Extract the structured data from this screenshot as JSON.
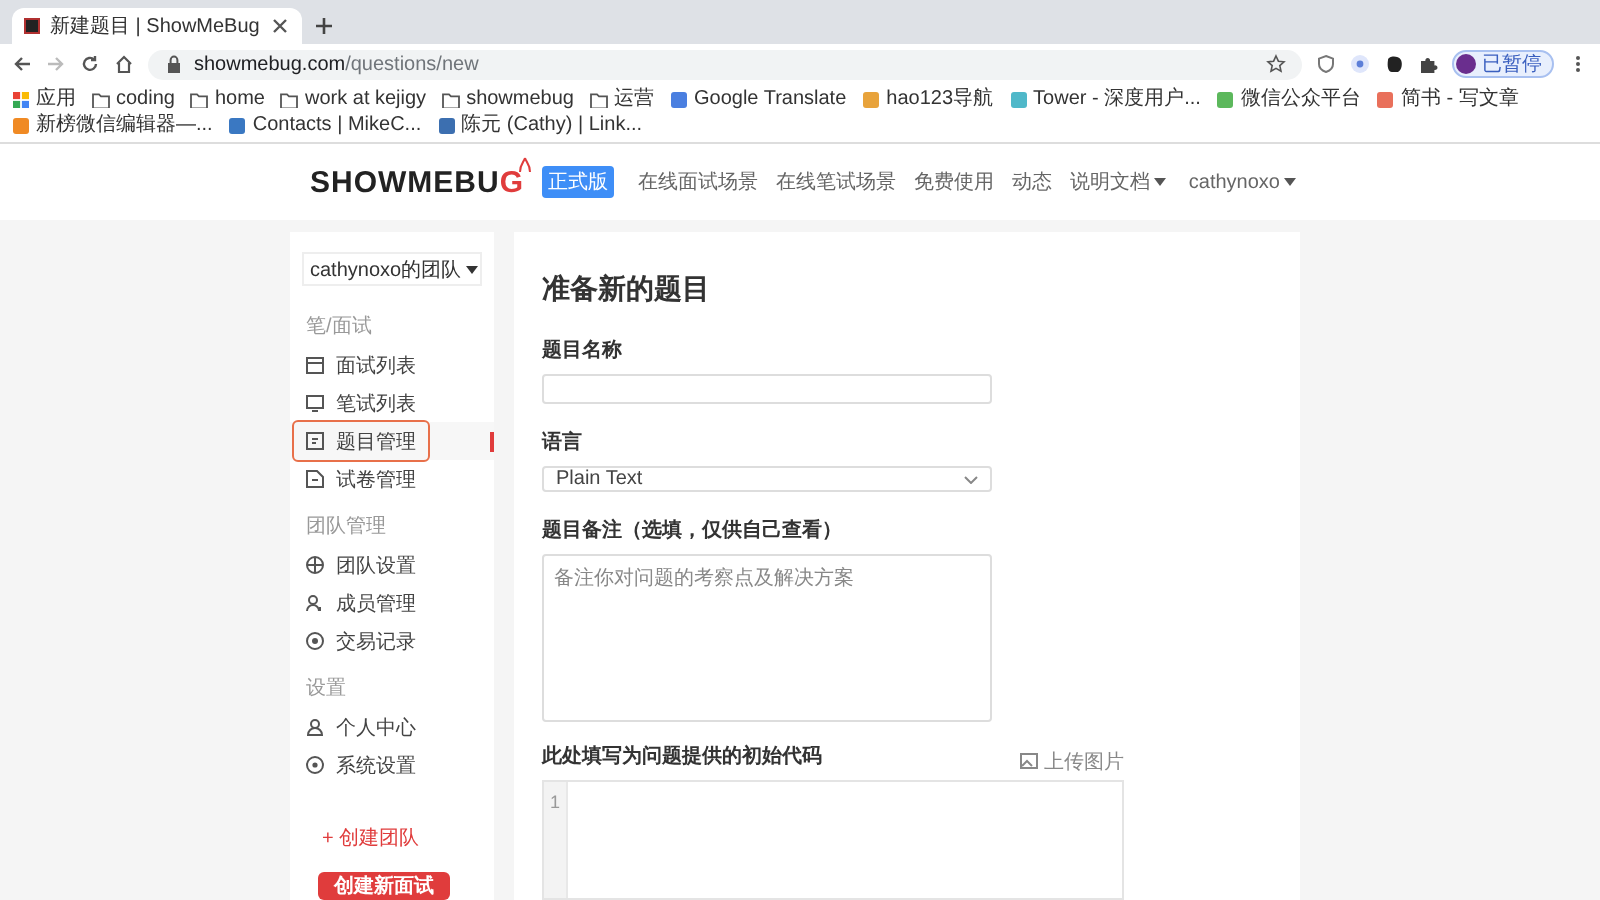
{
  "browser": {
    "tab": {
      "title": "新建题目 | ShowMeBug"
    },
    "url": {
      "host": "showmebug.com",
      "path": "/questions/new"
    },
    "profile": {
      "label": "已暂停"
    },
    "bookmarks": [
      {
        "kind": "apps",
        "label": "应用"
      },
      {
        "kind": "folder",
        "label": "coding"
      },
      {
        "kind": "folder",
        "label": "home"
      },
      {
        "kind": "folder",
        "label": "work at kejigy"
      },
      {
        "kind": "folder",
        "label": "showmebug"
      },
      {
        "kind": "folder",
        "label": "运营"
      },
      {
        "kind": "site",
        "label": "Google Translate",
        "color": "#4a7fe0"
      },
      {
        "kind": "site",
        "label": "hao123导航",
        "color": "#e8a33b"
      },
      {
        "kind": "site",
        "label": "Tower - 深度用户...",
        "color": "#4fb8c9"
      },
      {
        "kind": "site",
        "label": "微信公众平台",
        "color": "#5cb85c"
      },
      {
        "kind": "site",
        "label": "简书 - 写文章",
        "color": "#e9705b"
      },
      {
        "kind": "site",
        "label": "新榜微信编辑器—...",
        "color": "#f08a24"
      },
      {
        "kind": "site",
        "label": "Contacts | MikeC...",
        "color": "#3a78c2"
      },
      {
        "kind": "site",
        "label": "陈元 (Cathy) | Link...",
        "color": "#3c6fb0"
      }
    ]
  },
  "header": {
    "logo": "SHOWMEBUG",
    "badge": "正式版",
    "nav": [
      {
        "label": "在线面试场景",
        "dropdown": false
      },
      {
        "label": "在线笔试场景",
        "dropdown": false
      },
      {
        "label": "免费使用",
        "dropdown": false
      },
      {
        "label": "动态",
        "dropdown": false
      },
      {
        "label": "说明文档",
        "dropdown": true
      }
    ],
    "user": {
      "label": "cathynoxo"
    }
  },
  "sidebar": {
    "team_select": {
      "value": "cathynoxo的团队"
    },
    "sections": [
      {
        "title": "笔/面试",
        "items": [
          {
            "label": "面试列表",
            "selected": false
          },
          {
            "label": "笔试列表",
            "selected": false
          },
          {
            "label": "题目管理",
            "selected": true
          },
          {
            "label": "试卷管理",
            "selected": false
          }
        ]
      },
      {
        "title": "团队管理",
        "items": [
          {
            "label": "团队设置",
            "selected": false
          },
          {
            "label": "成员管理",
            "selected": false
          },
          {
            "label": "交易记录",
            "selected": false
          }
        ]
      },
      {
        "title": "设置",
        "items": [
          {
            "label": "个人中心",
            "selected": false
          },
          {
            "label": "系统设置",
            "selected": false
          }
        ]
      }
    ],
    "create_team": "+ 创建团队",
    "create_button": "创建新面试"
  },
  "form": {
    "title": "准备新的题目",
    "name_field": {
      "label": "题目名称"
    },
    "language": {
      "label": "语言",
      "value": "Plain Text"
    },
    "notes": {
      "label": "题目备注（选填，仅供自己查看）",
      "placeholder": "备注你对问题的考察点及解决方案"
    },
    "code": {
      "label": "此处填写为问题提供的初始代码",
      "upload": "上传图片",
      "line_numbers": [
        "1"
      ]
    }
  }
}
